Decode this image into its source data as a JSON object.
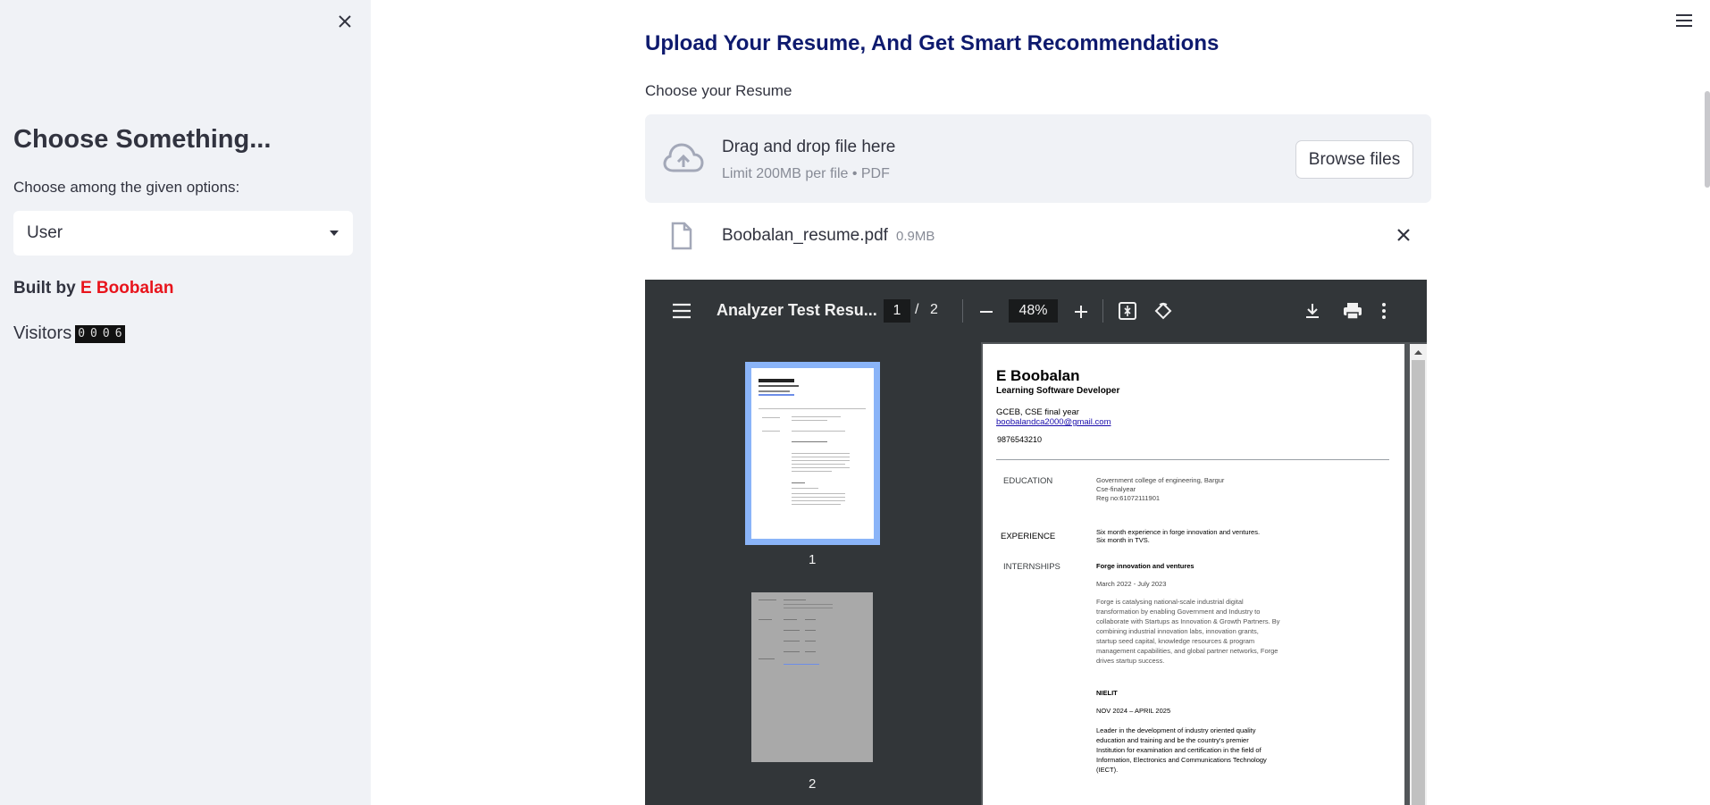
{
  "sidebar": {
    "title": "Choose Something...",
    "options_label": "Choose among the given options:",
    "selected_option": "User",
    "built_by_prefix": "Built by ",
    "author": "E Boobalan",
    "visitors_label": "Visitors",
    "visitor_digits": [
      "0",
      "0",
      "0",
      "6"
    ]
  },
  "main": {
    "title": "Upload Your Resume, And Get Smart Recommendations",
    "uploader_label": "Choose your Resume",
    "dropzone": {
      "main_text": "Drag and drop file here",
      "sub_text": "Limit 200MB per file • PDF",
      "browse_label": "Browse files"
    },
    "file": {
      "name": "Boobalan_resume.pdf",
      "size": "0.9MB"
    }
  },
  "pdf_viewer": {
    "doc_title": "Analyzer Test Resu...",
    "current_page": "1",
    "page_separator": "/",
    "total_pages": "2",
    "zoom": "48%",
    "thumbnails": [
      "1",
      "2"
    ]
  },
  "resume": {
    "name": "E Boobalan",
    "role": "Learning Software Developer",
    "college": "GCEB, CSE final year",
    "email": "boobalandca2000@gmail.com",
    "phone": "9876543210",
    "education_heading": "EDUCATION",
    "education_lines": [
      "Government college of engineering, Bargur",
      "Cse-finalyear",
      "Reg no:61072111901"
    ],
    "experience_heading": "EXPERIENCE",
    "experience_lines": [
      "Six month experience in forge innovation and ventures.",
      "Six month in TVS."
    ],
    "internships_heading": "INTERNSHIPS",
    "intern1_title": "Forge innovation and ventures",
    "intern1_dates": "March 2022 - July 2023",
    "intern1_desc": [
      "Forge is catalysing national-scale industrial digital",
      "transformation by enabling Government and Industry to",
      "collaborate with Startups as Innovation & Growth Partners. By",
      "combining industrial innovation labs, innovation grants,",
      "startup seed capital, knowledge resources & program",
      "management capabilities, and global partner networks, Forge",
      "drives startup success."
    ],
    "intern2_title": "NIELIT",
    "intern2_dates": "NOV 2024 – APRIL 2025",
    "intern2_desc": [
      "Leader in the development of industry oriented quality",
      "education and training and be the country's premier",
      "Institution for examination and certification in the field of",
      "Information, Electronics and Communications Technology",
      "(IECT)."
    ]
  },
  "colors": {
    "sidebar_bg": "#f0f2f6",
    "title_color": "#0e1a6e",
    "author_color": "#e8141c",
    "viewer_toolbar": "#323639",
    "thumb_selected": "#8ab4f8"
  },
  "icons": {
    "sidebar_close": "close-icon",
    "app_menu": "hamburger-menu-icon",
    "upload": "cloud-upload-icon",
    "file": "file-icon",
    "remove_file": "close-icon",
    "viewer_menu": "menu-icon",
    "zoom_out": "minus-icon",
    "zoom_in": "plus-icon",
    "fit_page": "fit-to-page-icon",
    "rotate": "rotate-icon",
    "download": "download-icon",
    "print": "print-icon",
    "more": "more-vert-icon"
  }
}
